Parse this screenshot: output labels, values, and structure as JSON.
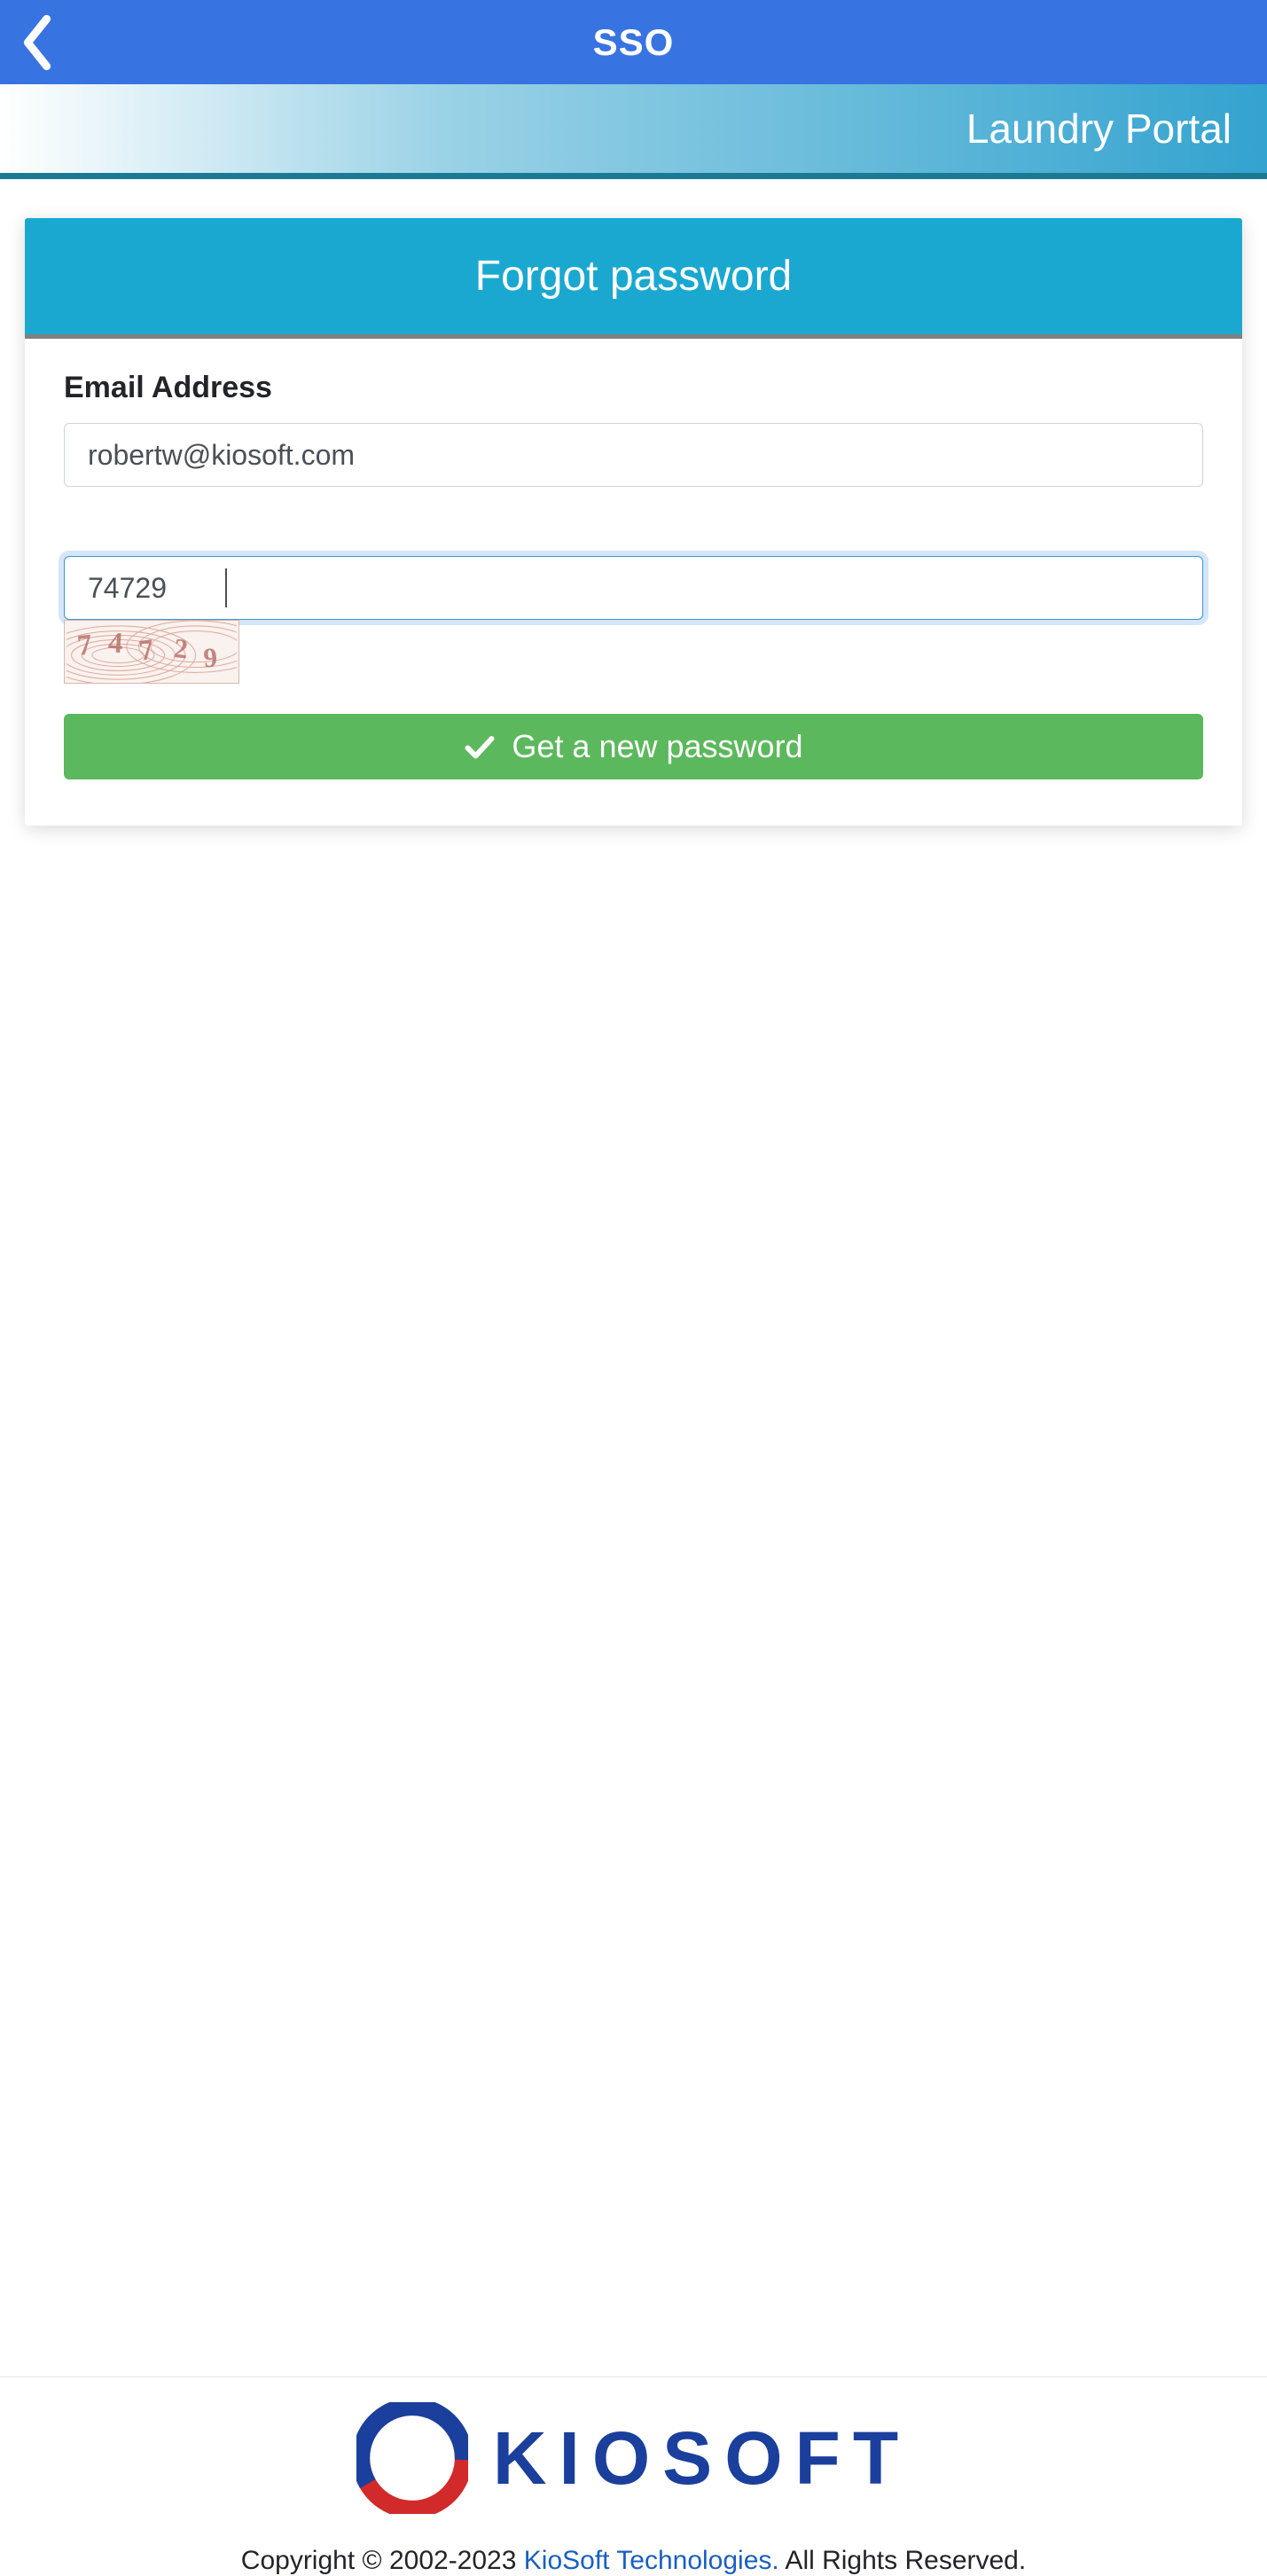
{
  "nav": {
    "title": "SSO"
  },
  "portal": {
    "label": "Laundry Portal"
  },
  "card": {
    "title": "Forgot password",
    "email_label": "Email Address",
    "email_value": "robertw@kiosoft.com",
    "captcha_value": "74729",
    "captcha_image_text": "74729",
    "submit_label": "Get a new password"
  },
  "footer": {
    "brand": "KIOSOFT",
    "copyright_prefix": "Copyright © 2002-2023 ",
    "company_link": "KioSoft Technologies.",
    "copyright_suffix": " All Rights Reserved."
  }
}
